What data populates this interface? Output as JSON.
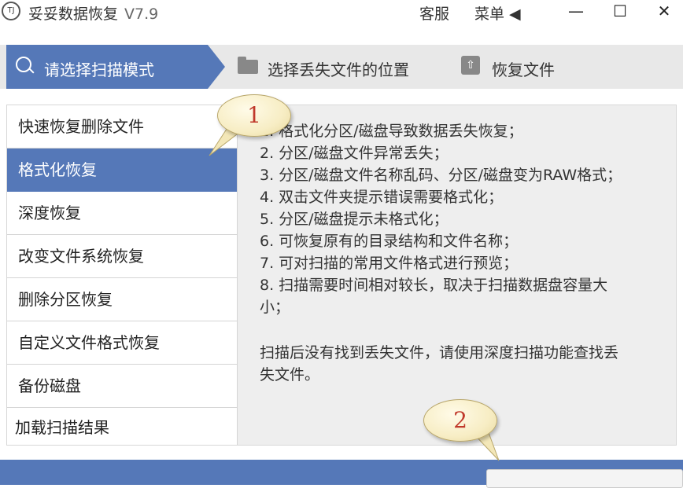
{
  "window": {
    "title": "妥妥数据恢复",
    "version": "V7.9",
    "links": {
      "service": "客服",
      "menu": "菜单 ◀"
    },
    "controls": {
      "minimize": "—",
      "maximize": "☐",
      "close": "✕"
    }
  },
  "steps": [
    {
      "label": "请选择扫描模式",
      "active": true
    },
    {
      "label": "选择丢失文件的位置",
      "active": false
    },
    {
      "label": "恢复文件",
      "active": false
    }
  ],
  "modes": [
    {
      "label": "快速恢复删除文件",
      "active": false
    },
    {
      "label": "格式化恢复",
      "active": true
    },
    {
      "label": "深度恢复",
      "active": false
    },
    {
      "label": "改变文件系统恢复",
      "active": false
    },
    {
      "label": "删除分区恢复",
      "active": false
    },
    {
      "label": "自定义文件格式恢复",
      "active": false
    },
    {
      "label": "备份磁盘",
      "active": false
    },
    {
      "label": "加载扫描结果",
      "active": false
    }
  ],
  "description": {
    "lines": [
      "1. 格式化分区/磁盘导致数据丢失恢复；",
      "2. 分区/磁盘文件异常丢失；",
      "3. 分区/磁盘文件名称乱码、分区/磁盘变为RAW格式；",
      "4. 双击文件夹提示错误需要格式化；",
      "5. 分区/磁盘提示未格式化；",
      "6. 可恢复原有的目录结构和文件名称；",
      "7. 可对扫描的常用文件格式进行预览；",
      "8. 扫描需要时间相对较长，取决于扫描数据盘容量大",
      "小；",
      "扫描后没有找到丢失文件，请使用深度扫描功能查找丢",
      "失文件。"
    ]
  },
  "callouts": {
    "first": "1",
    "second": "2"
  },
  "colors": {
    "accent": "#5578b8",
    "panel": "#eeeeee",
    "callout_text": "#c0392b"
  }
}
